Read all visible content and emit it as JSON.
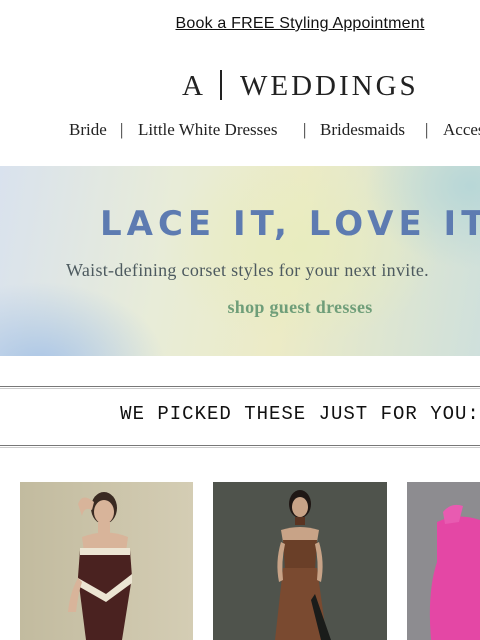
{
  "promo": {
    "text": "Book a FREE Styling Appointment"
  },
  "logo": {
    "letter": "A",
    "brand": "WEDDINGS"
  },
  "nav": {
    "items": [
      "Bride",
      "Little White Dresses",
      "Bridesmaids",
      "Acces"
    ],
    "separator": "|"
  },
  "hero": {
    "headline": "LACE IT, LOVE IT",
    "subtitle": "Waist-defining corset styles for your next invite.",
    "cta": "shop guest dresses"
  },
  "section": {
    "title": "WE PICKED THESE JUST FOR YOU:"
  },
  "products": [
    {
      "name": "strapless-brown-cream-trim-dress",
      "bg": "#c9c1a7",
      "dress": "#4b2220",
      "trim": "#ece5d3"
    },
    {
      "name": "brown-corset-dress",
      "bg": "#4e524b",
      "dress": "#7a4a30",
      "trim": "#6a3f28"
    },
    {
      "name": "pink-dress",
      "bg": "#8b8a8e",
      "dress": "#e447a5",
      "trim": "#e447a5"
    }
  ],
  "colors": {
    "hero_headline": "#5d7bb1",
    "cta": "#6f9e79",
    "text": "#222222"
  }
}
